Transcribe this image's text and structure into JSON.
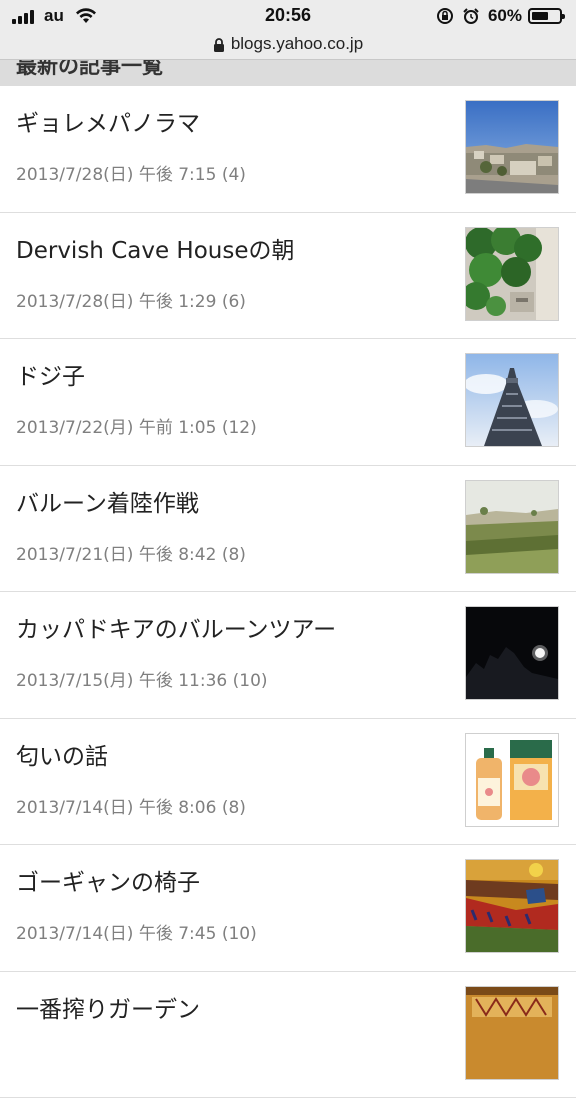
{
  "status_bar": {
    "carrier": "au",
    "time": "20:56",
    "battery_percent": "60%",
    "battery_level": 0.6
  },
  "url_bar": {
    "url": "blogs.yahoo.co.jp"
  },
  "section": {
    "title": "最新の記事一覧"
  },
  "articles": [
    {
      "title": "ギョレメパノラマ",
      "meta": "2013/7/28(日) 午後 7:15 (4)",
      "thumbnail": "cappadocia-town"
    },
    {
      "title": "Dervish Cave Houseの朝",
      "meta": "2013/7/28(日) 午後 1:29 (6)",
      "thumbnail": "ivy-wall"
    },
    {
      "title": "ドジ子",
      "meta": "2013/7/22(月) 午前 1:05 (12)",
      "thumbnail": "sky-tower"
    },
    {
      "title": "バルーン着陸作戦",
      "meta": "2013/7/21(日) 午後 8:42 (8)",
      "thumbnail": "balloon-field"
    },
    {
      "title": "カッパドキアのバルーンツアー",
      "meta": "2013/7/15(月) 午後 11:36 (10)",
      "thumbnail": "night-moon"
    },
    {
      "title": "匂いの話",
      "meta": "2013/7/14(日) 午後 8:06 (8)",
      "thumbnail": "bath-products"
    },
    {
      "title": "ゴーギャンの椅子",
      "meta": "2013/7/14(日) 午後 7:45 (10)",
      "thumbnail": "red-vineyard-painting"
    },
    {
      "title": "一番搾りガーデン",
      "meta": "",
      "thumbnail": "garden-sign"
    }
  ]
}
